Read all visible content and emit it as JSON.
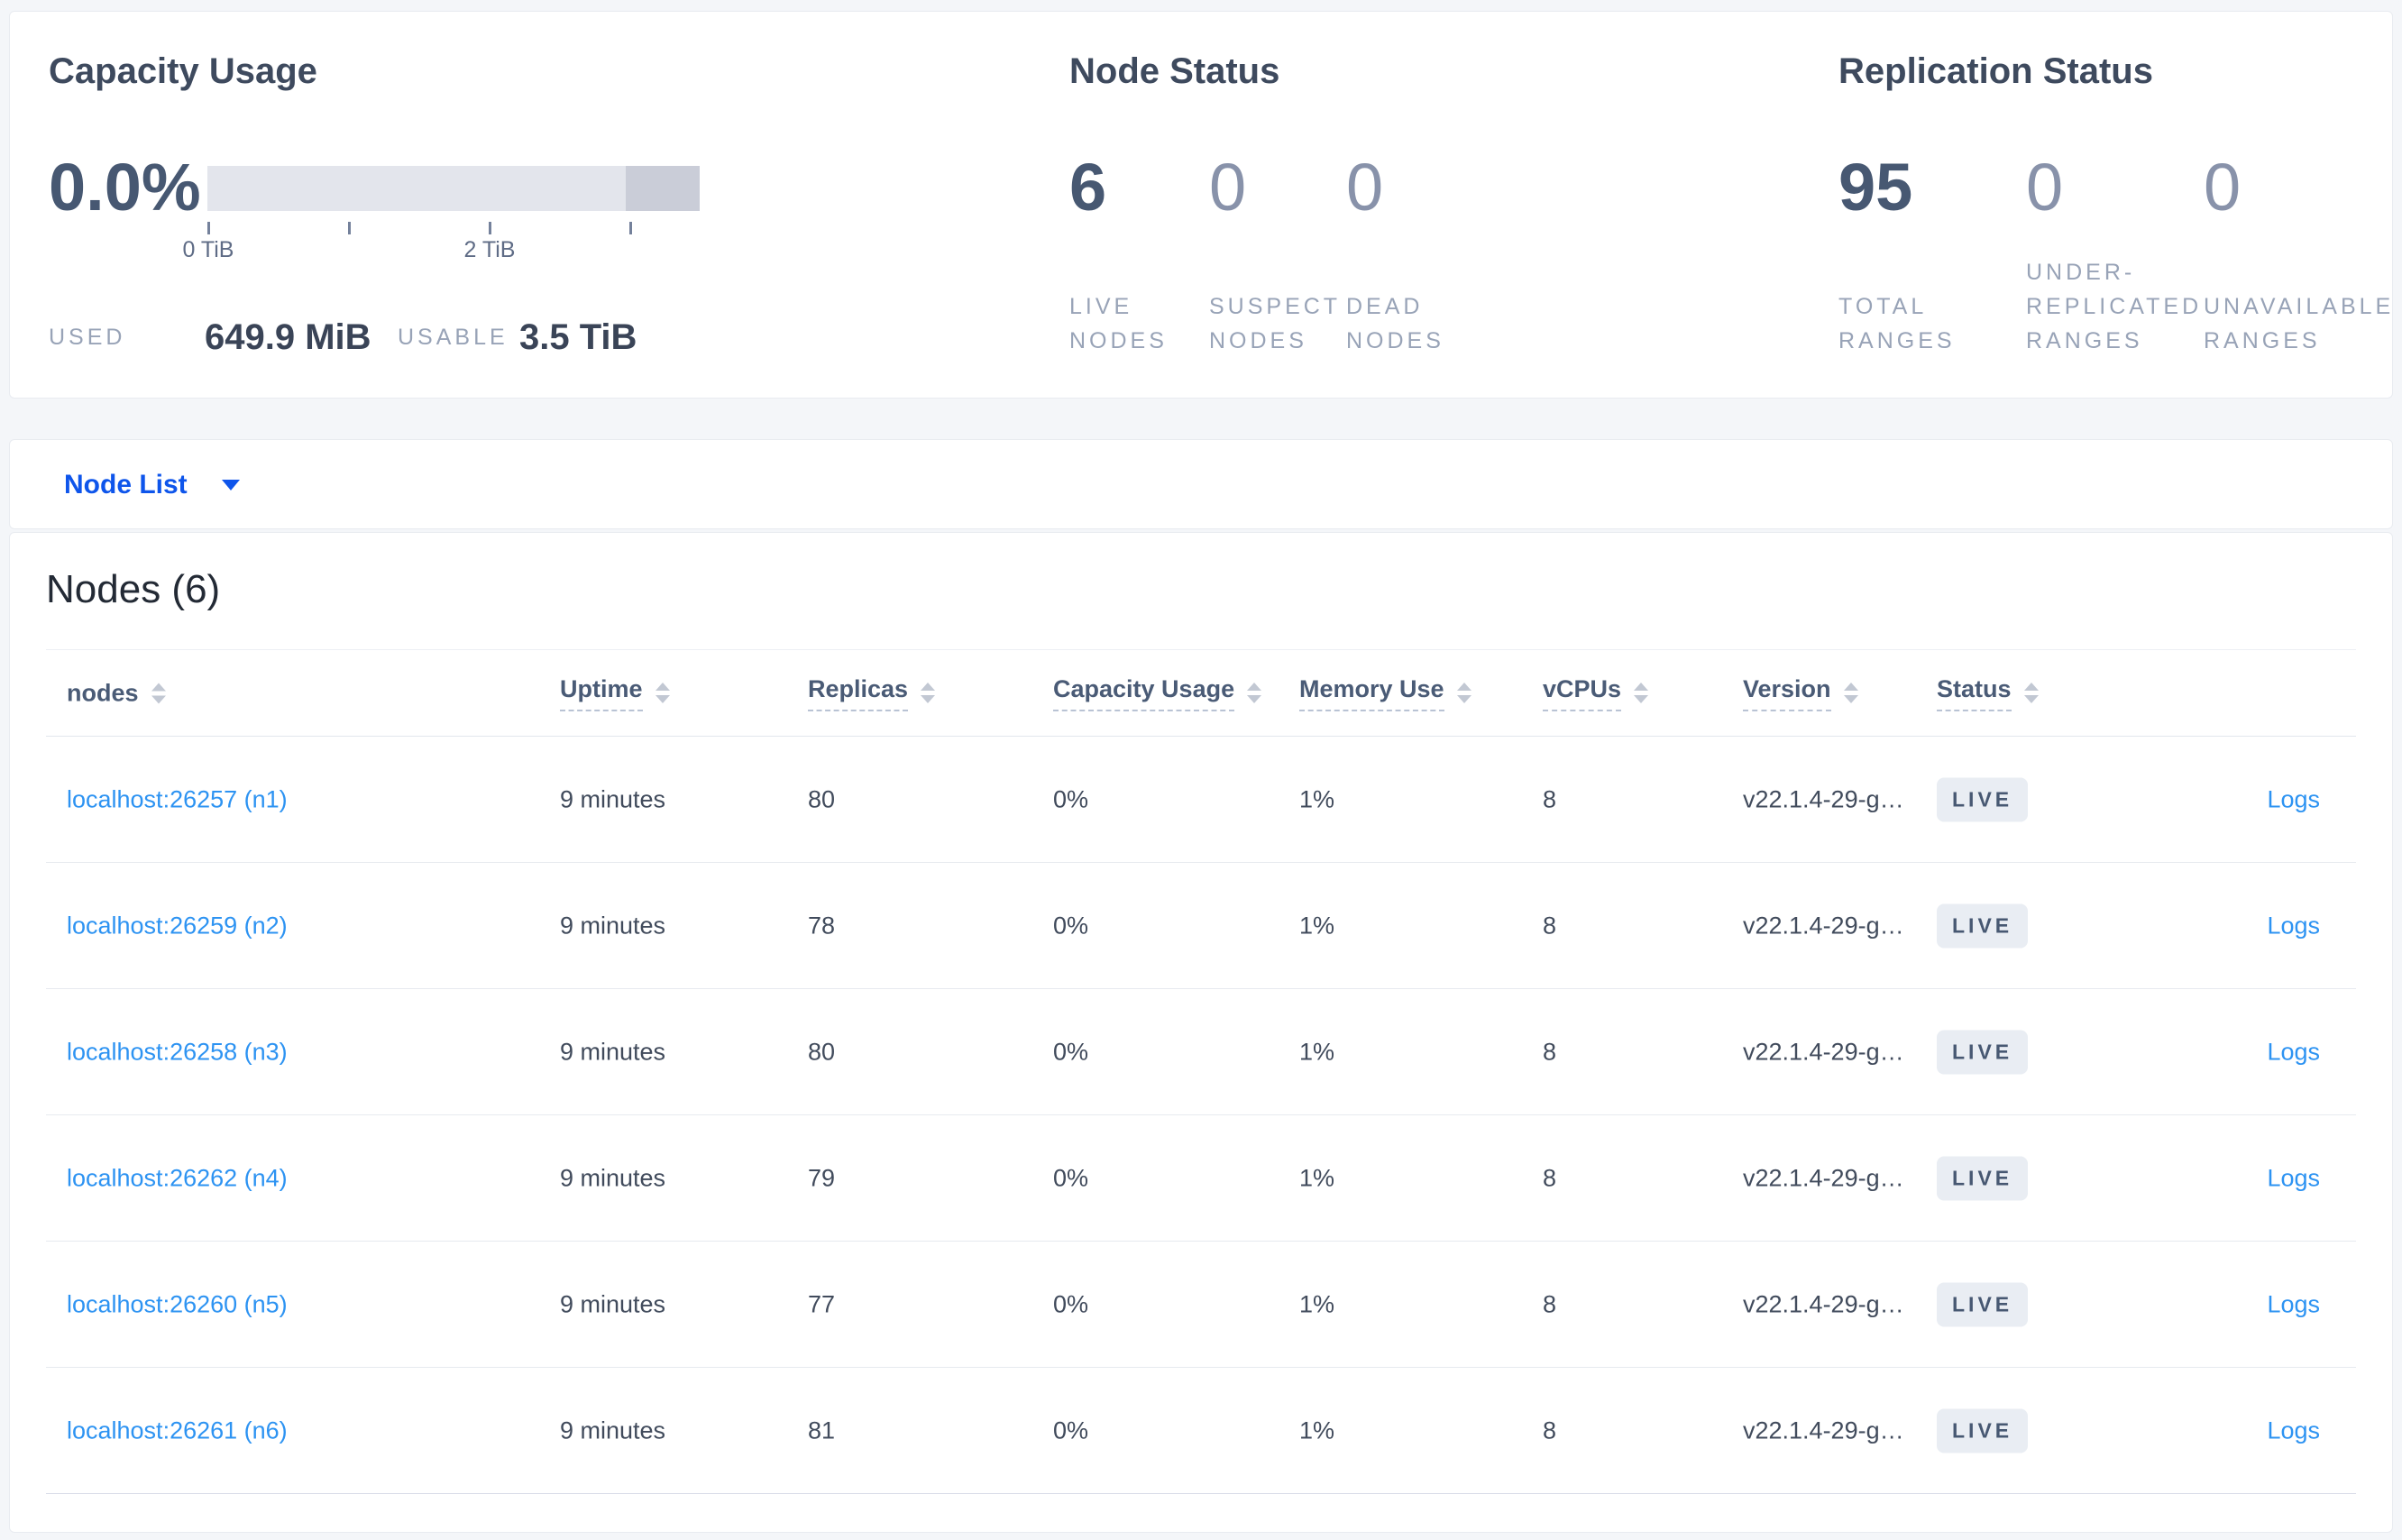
{
  "overview": {
    "capacity": {
      "title": "Capacity Usage",
      "percent": "0.0%",
      "tick_labels": [
        "0 TiB",
        "2 TiB"
      ],
      "used_label": "USED",
      "used_value": "649.9 MiB",
      "usable_label": "USABLE",
      "usable_value": "3.5 TiB"
    },
    "node_status": {
      "title": "Node Status",
      "stats": [
        {
          "value": "6",
          "label": "LIVE NODES"
        },
        {
          "value": "0",
          "label": "SUSPECT NODES"
        },
        {
          "value": "0",
          "label": "DEAD NODES"
        }
      ]
    },
    "replication": {
      "title": "Replication Status",
      "stats": [
        {
          "value": "95",
          "label": "TOTAL RANGES"
        },
        {
          "value": "0",
          "label": "UNDER- REPLICATED RANGES"
        },
        {
          "value": "0",
          "label": "UNAVAILABLE RANGES"
        }
      ]
    }
  },
  "view_selector": {
    "label": "Node List"
  },
  "table": {
    "title": "Nodes (6)",
    "headers": [
      {
        "label": "nodes"
      },
      {
        "label": "Uptime"
      },
      {
        "label": "Replicas"
      },
      {
        "label": "Capacity Usage"
      },
      {
        "label": "Memory Use"
      },
      {
        "label": "vCPUs"
      },
      {
        "label": "Version"
      },
      {
        "label": "Status"
      }
    ],
    "logs_label": "Logs",
    "rows": [
      {
        "node": "localhost:26257 (n1)",
        "uptime": "9 minutes",
        "replicas": "80",
        "capacity_usage": "0%",
        "memory_use": "1%",
        "vcpus": "8",
        "version": "v22.1.4-29-g…",
        "status": "LIVE"
      },
      {
        "node": "localhost:26259 (n2)",
        "uptime": "9 minutes",
        "replicas": "78",
        "capacity_usage": "0%",
        "memory_use": "1%",
        "vcpus": "8",
        "version": "v22.1.4-29-g…",
        "status": "LIVE"
      },
      {
        "node": "localhost:26258 (n3)",
        "uptime": "9 minutes",
        "replicas": "80",
        "capacity_usage": "0%",
        "memory_use": "1%",
        "vcpus": "8",
        "version": "v22.1.4-29-g…",
        "status": "LIVE"
      },
      {
        "node": "localhost:26262 (n4)",
        "uptime": "9 minutes",
        "replicas": "79",
        "capacity_usage": "0%",
        "memory_use": "1%",
        "vcpus": "8",
        "version": "v22.1.4-29-g…",
        "status": "LIVE"
      },
      {
        "node": "localhost:26260 (n5)",
        "uptime": "9 minutes",
        "replicas": "77",
        "capacity_usage": "0%",
        "memory_use": "1%",
        "vcpus": "8",
        "version": "v22.1.4-29-g…",
        "status": "LIVE"
      },
      {
        "node": "localhost:26261 (n6)",
        "uptime": "9 minutes",
        "replicas": "81",
        "capacity_usage": "0%",
        "memory_use": "1%",
        "vcpus": "8",
        "version": "v22.1.4-29-g…",
        "status": "LIVE"
      }
    ]
  },
  "colors": {
    "accent_blue": "#0e55eb",
    "table_link_blue": "#2d93f2",
    "stat_primary": "#475872",
    "stat_muted": "#8892aa",
    "badge_bg": "#e9edf3",
    "badge_text": "#475872",
    "gauge_light": "#e3e5ec",
    "gauge_dark": "#cacdd8",
    "page_bg": "#f4f6f9"
  }
}
